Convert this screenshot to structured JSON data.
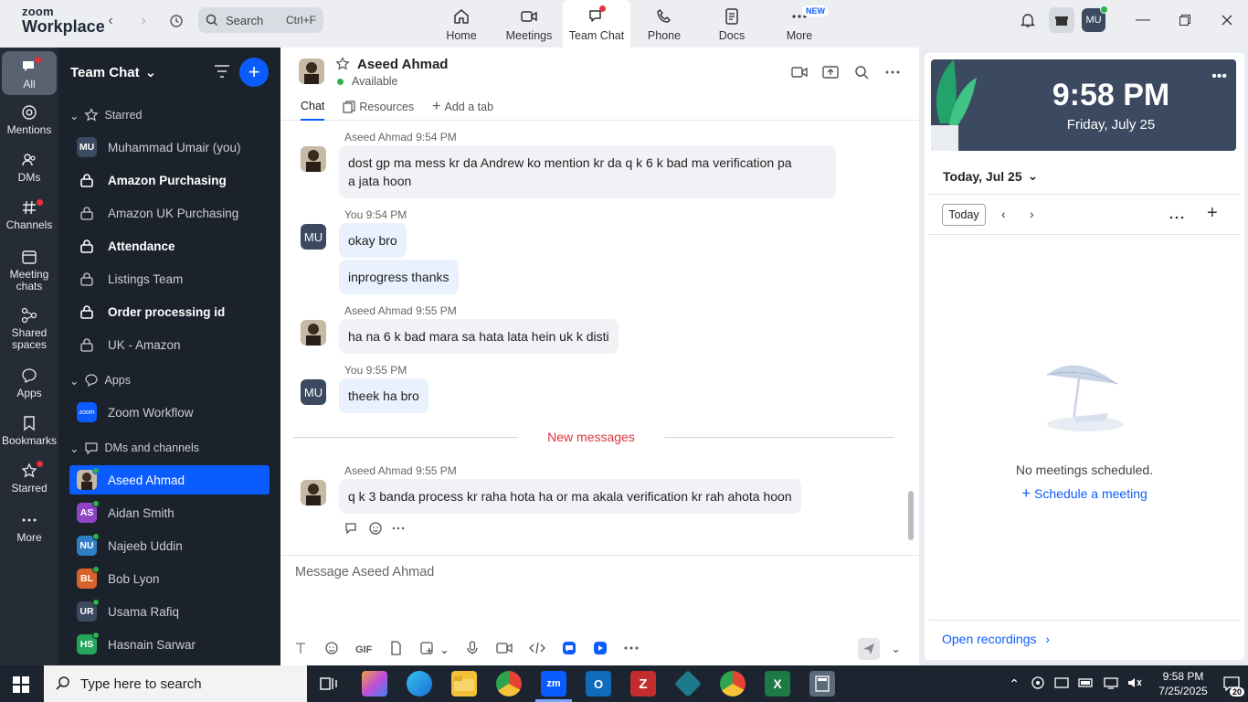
{
  "app": {
    "logo_line1": "zoom",
    "logo_line2": "Workplace"
  },
  "search": {
    "label": "Search",
    "shortcut": "Ctrl+F"
  },
  "topnav": [
    {
      "label": "Home",
      "icon": "home-icon"
    },
    {
      "label": "Meetings",
      "icon": "video-camera-icon"
    },
    {
      "label": "Team Chat",
      "icon": "chat-bubble-icon",
      "active": true
    },
    {
      "label": "Phone",
      "icon": "phone-icon"
    },
    {
      "label": "Docs",
      "icon": "document-icon"
    },
    {
      "label": "More",
      "icon": "more-icon",
      "badge": "NEW"
    }
  ],
  "user": {
    "initials": "MU"
  },
  "rail": [
    {
      "label": "All",
      "icon": "chat-bubble-icon"
    },
    {
      "label": "Mentions",
      "icon": "at-sign-icon"
    },
    {
      "label": "DMs",
      "icon": "people-icon"
    },
    {
      "label": "Channels",
      "icon": "hashtag-icon"
    },
    {
      "label": "Meeting chats",
      "icon": "calendar-icon"
    },
    {
      "label": "Shared spaces",
      "icon": "shared-spaces-icon"
    },
    {
      "label": "Apps",
      "icon": "apps-bubble-icon"
    },
    {
      "label": "Bookmarks",
      "icon": "bookmark-icon"
    },
    {
      "label": "Starred",
      "icon": "star-icon"
    },
    {
      "label": "More",
      "icon": "more-dots-icon"
    }
  ],
  "sidebar": {
    "title": "Team Chat",
    "sections": {
      "starred": "Starred",
      "apps": "Apps",
      "dms": "DMs and channels"
    },
    "starred": [
      {
        "label": "Muhammad Umair (you)",
        "initials": "MU"
      },
      {
        "label": "Amazon Purchasing"
      },
      {
        "label": "Amazon UK Purchasing"
      },
      {
        "label": "Attendance"
      },
      {
        "label": "Listings Team"
      },
      {
        "label": "Order processing id"
      },
      {
        "label": "UK - Amazon"
      }
    ],
    "apps": [
      {
        "label": "Zoom Workflow",
        "icon_text": "zoom"
      }
    ],
    "dms": [
      {
        "label": "Aseed Ahmad"
      },
      {
        "label": "Aidan Smith",
        "initials": "AS",
        "color": "#8e44c4"
      },
      {
        "label": "Najeeb Uddin",
        "initials": "NU",
        "color": "#2f7fc4"
      },
      {
        "label": "Bob Lyon",
        "initials": "BL",
        "color": "#d9622b"
      },
      {
        "label": "Usama Rafiq",
        "initials": "UR",
        "color": "#3b4a60"
      },
      {
        "label": "Hasnain Sarwar",
        "initials": "HS",
        "color": "#25a55a"
      }
    ]
  },
  "chat": {
    "contact": "Aseed Ahmad",
    "status": "Available",
    "tabs": [
      "Chat",
      "Resources",
      "Add a tab"
    ],
    "messages": [
      {
        "sender": "Aseed Ahmad",
        "time": "9:54 PM",
        "lines": [
          "dost gp ma mess kr da Andrew ko mention kr da q k 6 k bad ma verification pa",
          "a jata hoon"
        ]
      },
      {
        "sender": "You",
        "time": "9:54 PM",
        "lines": [
          "okay bro"
        ]
      },
      {
        "sender": "",
        "time": "",
        "lines": [
          "inprogress thanks"
        ]
      },
      {
        "sender": "Aseed Ahmad",
        "time": "9:55 PM",
        "lines": [
          "ha na 6 k bad mara sa hata lata hein uk k disti"
        ]
      },
      {
        "sender": "You",
        "time": "9:55 PM",
        "lines": [
          "theek ha bro"
        ]
      },
      {
        "sender": "Aseed Ahmad",
        "time": "9:55 PM",
        "lines": [
          "q k 3 banda process kr raha hota ha or ma akala verification kr rah ahota hoon"
        ]
      }
    ],
    "new_messages": "New messages",
    "composer_placeholder": "Message Aseed Ahmad",
    "gif_label": "GIF"
  },
  "calendar": {
    "time": "9:58 PM",
    "date": "Friday, July 25",
    "today_header": "Today, Jul 25",
    "today_button": "Today",
    "empty": "No meetings scheduled.",
    "schedule": "Schedule a meeting",
    "open_recordings": "Open recordings"
  },
  "taskbar": {
    "search_placeholder": "Type here to search",
    "time": "9:58 PM",
    "date": "7/25/2025",
    "notifications": "20"
  }
}
